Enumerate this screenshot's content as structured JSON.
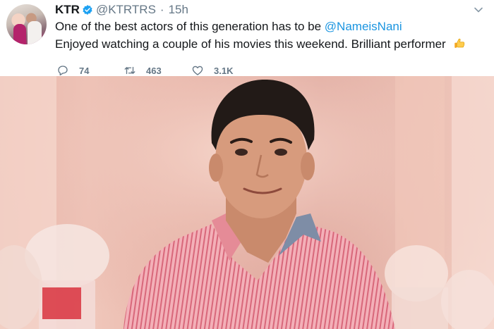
{
  "tweet": {
    "display_name": "KTR",
    "handle": "@KTRTRS",
    "separator": "·",
    "time": "15h",
    "line1_text": "One of the best actors of this generation has to be ",
    "mention": "@NameisNani",
    "line2_text": "Enjoyed watching a couple of his movies this weekend. Brilliant performer",
    "emoji": "thumbs-up",
    "reply_count": "74",
    "retweet_count": "463",
    "like_count": "3.1K"
  },
  "icons": {
    "verified": "verified-badge-icon",
    "more": "chevron-down-icon",
    "reply": "reply-icon",
    "retweet": "retweet-icon",
    "like": "heart-icon"
  },
  "colors": {
    "accent": "#1b95e0",
    "meta_text": "#657786",
    "text": "#14171a"
  }
}
